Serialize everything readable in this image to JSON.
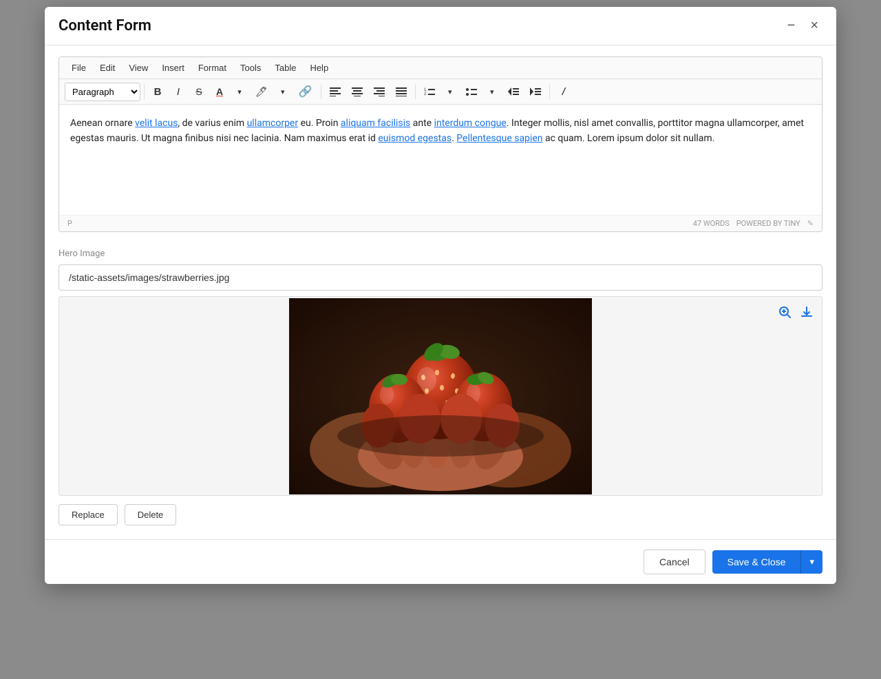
{
  "modal": {
    "title": "Content Form",
    "minimize_label": "−",
    "close_label": "×"
  },
  "menubar": {
    "items": [
      "File",
      "Edit",
      "View",
      "Insert",
      "Format",
      "Tools",
      "Table",
      "Help"
    ]
  },
  "toolbar": {
    "paragraph_label": "Paragraph",
    "bold_label": "B",
    "italic_label": "I",
    "strikethrough_label": "S",
    "link_label": "🔗",
    "align_left": "≡",
    "align_center": "≡",
    "align_right": "≡",
    "align_justify": "≡",
    "ordered_list": "≡",
    "unordered_list": "≡",
    "indent_decrease": "≡",
    "indent_increase": "≡",
    "clear_format": "𝐼"
  },
  "editor": {
    "content_text": "Aenean ornare velit lacus, de varius enim ullamcorper eu. Proin aliquam facilisis ante interdum congue. Integer mollis, nisl amet convallis, porttitor magna ullamcorper, amet egestas mauris. Ut magna finibus nisi nec lacinia. Nam maximus erat id euismod egestas. Pellentesque sapien ac quam. Lorem ipsum dolor sit nullam.",
    "paragraph_tag": "P",
    "word_count": "47 WORDS",
    "powered_by": "POWERED BY TINY",
    "link_words": [
      "velit lacus",
      "ullamcorper",
      "aliquam facilisis",
      "interdum congue",
      "euismod egestas",
      "Pellentesque sapien"
    ]
  },
  "hero_image": {
    "label": "Hero Image",
    "value": "/static-assets/images/strawberries.jpg",
    "placeholder": "/static-assets/images/strawberries.jpg"
  },
  "image_buttons": {
    "replace_label": "Replace",
    "delete_label": "Delete"
  },
  "footer": {
    "cancel_label": "Cancel",
    "save_label": "Save & Close",
    "dropdown_label": "▾"
  }
}
